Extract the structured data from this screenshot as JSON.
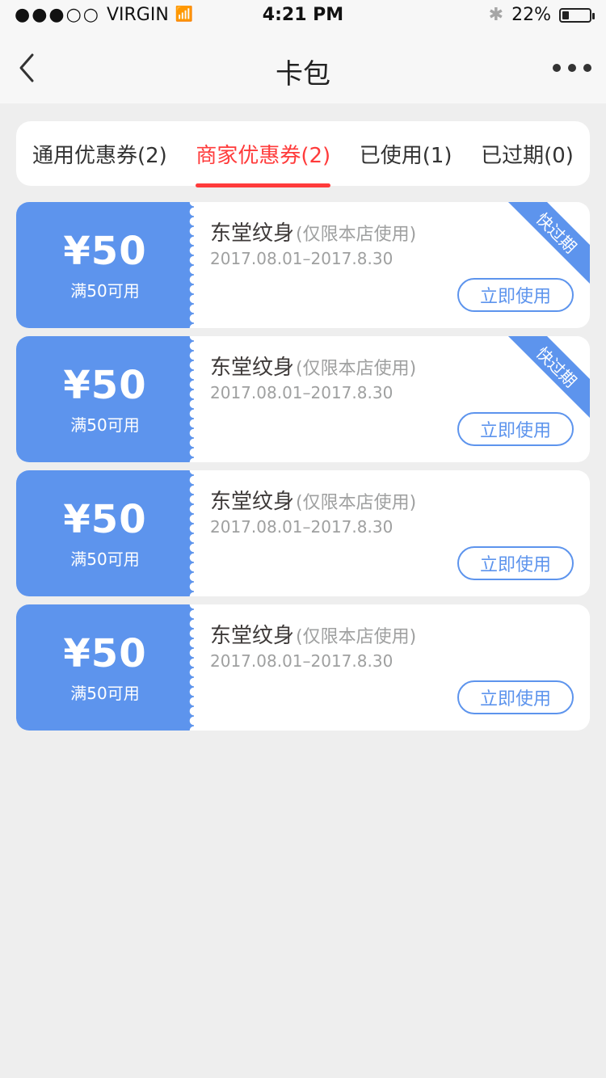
{
  "status": {
    "carrier": "VIRGIN",
    "time": "4:21 PM",
    "battery": "22%",
    "battery_level": 0.22
  },
  "nav": {
    "title": "卡包"
  },
  "tabs": [
    {
      "label": "通用优惠券(2)",
      "active": false
    },
    {
      "label": "商家优惠券(2)",
      "active": true
    },
    {
      "label": "已使用(1)",
      "active": false
    },
    {
      "label": "已过期(0)",
      "active": false
    }
  ],
  "coupons": [
    {
      "amount": "¥50",
      "condition": "满50可用",
      "merchant": "东堂纹身",
      "note": "(仅限本店使用)",
      "dates": "2017.08.01–2017.8.30",
      "button": "立即使用",
      "badge": "快过期"
    },
    {
      "amount": "¥50",
      "condition": "满50可用",
      "merchant": "东堂纹身",
      "note": "(仅限本店使用)",
      "dates": "2017.08.01–2017.8.30",
      "button": "立即使用",
      "badge": "快过期"
    },
    {
      "amount": "¥50",
      "condition": "满50可用",
      "merchant": "东堂纹身",
      "note": "(仅限本店使用)",
      "dates": "2017.08.01–2017.8.30",
      "button": "立即使用",
      "badge": ""
    },
    {
      "amount": "¥50",
      "condition": "满50可用",
      "merchant": "东堂纹身",
      "note": "(仅限本店使用)",
      "dates": "2017.08.01–2017.8.30",
      "button": "立即使用",
      "badge": ""
    }
  ],
  "colors": {
    "accent_blue": "#5d94ed",
    "active_tab_red": "#ff3b3b",
    "title_text": "#3e3a39",
    "muted_text": "#9fa0a0",
    "background": "#eeeeee"
  },
  "icons": [
    "signal-icon",
    "wifi-icon",
    "bluetooth-icon",
    "battery-icon",
    "back-chevron-icon",
    "more-icon"
  ]
}
